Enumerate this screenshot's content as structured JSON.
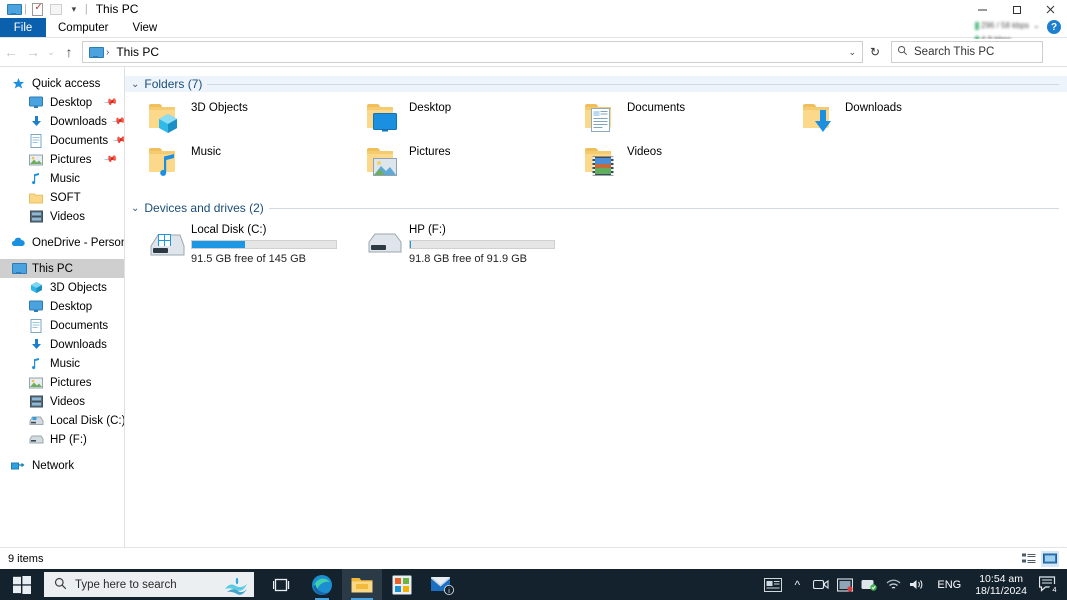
{
  "window": {
    "title": "This PC",
    "quick_access": [
      "monitor-icon",
      "properties-icon",
      "new-folder-icon",
      "customize-caret"
    ],
    "controls": {
      "minimize": "minimize-button",
      "maximize": "maximize-button",
      "close": "close-button"
    }
  },
  "ribbon": {
    "tabs": [
      {
        "label": "File",
        "active_file": true
      },
      {
        "label": "Computer",
        "active_file": false
      },
      {
        "label": "View",
        "active_file": false
      }
    ],
    "help": "?"
  },
  "net_widget": {
    "line1": "296 / 58 kbps",
    "line2": "4.9 kbps"
  },
  "addressbar": {
    "back": "←",
    "forward": "→",
    "recent": "⌄",
    "up": "↑",
    "crumb_root": "This PC",
    "separator": "›",
    "dropdown_caret": "⌄",
    "refresh": "↻"
  },
  "search": {
    "placeholder": "Search This PC",
    "icon": "search-icon"
  },
  "sidebar": {
    "groups": [
      {
        "name": "quick-access",
        "header": {
          "label": "Quick access",
          "icon": "star-pin-icon"
        },
        "items": [
          {
            "label": "Desktop",
            "icon": "desktop-icon",
            "pinned": true
          },
          {
            "label": "Downloads",
            "icon": "download-icon",
            "pinned": true
          },
          {
            "label": "Documents",
            "icon": "document-icon",
            "pinned": true
          },
          {
            "label": "Pictures",
            "icon": "pictures-icon",
            "pinned": true
          },
          {
            "label": "Music",
            "icon": "music-icon",
            "pinned": false
          },
          {
            "label": "SOFT",
            "icon": "folder-icon",
            "pinned": false
          },
          {
            "label": "Videos",
            "icon": "video-icon",
            "pinned": false
          }
        ]
      },
      {
        "name": "onedrive",
        "header": {
          "label": "OneDrive - Personal",
          "icon": "cloud-icon"
        },
        "items": []
      },
      {
        "name": "this-pc",
        "header": {
          "label": "This PC",
          "icon": "monitor-icon",
          "selected": true
        },
        "items": [
          {
            "label": "3D Objects",
            "icon": "3d-objects-icon"
          },
          {
            "label": "Desktop",
            "icon": "desktop-icon"
          },
          {
            "label": "Documents",
            "icon": "document-icon"
          },
          {
            "label": "Downloads",
            "icon": "download-icon"
          },
          {
            "label": "Music",
            "icon": "music-icon"
          },
          {
            "label": "Pictures",
            "icon": "pictures-icon"
          },
          {
            "label": "Videos",
            "icon": "video-icon"
          },
          {
            "label": "Local Disk (C:)",
            "icon": "drive-icon"
          },
          {
            "label": "HP (F:)",
            "icon": "drive-icon"
          }
        ]
      },
      {
        "name": "network",
        "header": {
          "label": "Network",
          "icon": "network-icon"
        },
        "items": []
      }
    ]
  },
  "content": {
    "folders_group": {
      "title": "Folders (7)",
      "chevron": "⌄",
      "items": [
        {
          "label": "3D Objects",
          "icon": "3d-objects-folder-icon"
        },
        {
          "label": "Desktop",
          "icon": "desktop-folder-icon"
        },
        {
          "label": "Documents",
          "icon": "documents-folder-icon"
        },
        {
          "label": "Downloads",
          "icon": "downloads-folder-icon"
        },
        {
          "label": "Music",
          "icon": "music-folder-icon"
        },
        {
          "label": "Pictures",
          "icon": "pictures-folder-icon"
        },
        {
          "label": "Videos",
          "icon": "videos-folder-icon"
        }
      ]
    },
    "drives_group": {
      "title": "Devices and drives (2)",
      "chevron": "⌄",
      "items": [
        {
          "label": "Local Disk (C:)",
          "icon": "windows-drive-icon",
          "free_text": "91.5 GB free of 145 GB",
          "used_percent": 37
        },
        {
          "label": "HP (F:)",
          "icon": "drive-icon",
          "free_text": "91.8 GB free of 91.9 GB",
          "used_percent": 1
        }
      ]
    }
  },
  "statusbar": {
    "items_count": "9 items",
    "view_details": "details-view-button",
    "view_large_icons": "large-icons-view-button"
  },
  "taskbar": {
    "start": "start-button",
    "search_placeholder": "Type here to search",
    "cortana": "cortana-icon",
    "apps": [
      {
        "name": "task-view",
        "label": "Task View"
      },
      {
        "name": "edge",
        "label": "Microsoft Edge"
      },
      {
        "name": "file-explorer",
        "label": "File Explorer"
      },
      {
        "name": "microsoft-store",
        "label": "Microsoft Store"
      },
      {
        "name": "mail",
        "label": "Mail"
      }
    ],
    "tray": {
      "news": "news-and-interests-icon",
      "chevron": "^",
      "icons": [
        "meet-now-icon",
        "onedrive-icon",
        "security-icon",
        "wifi-icon",
        "volume-icon"
      ],
      "language": "ENG",
      "time": "10:54 am",
      "date": "18/11/2024",
      "notification_count": "4"
    }
  },
  "colors": {
    "accent": "#0b60ad",
    "taskbar": "#14222e",
    "group_title": "#1b4d7a",
    "bar_fill": "#1b97e3",
    "selection": "#cfcfcf"
  }
}
